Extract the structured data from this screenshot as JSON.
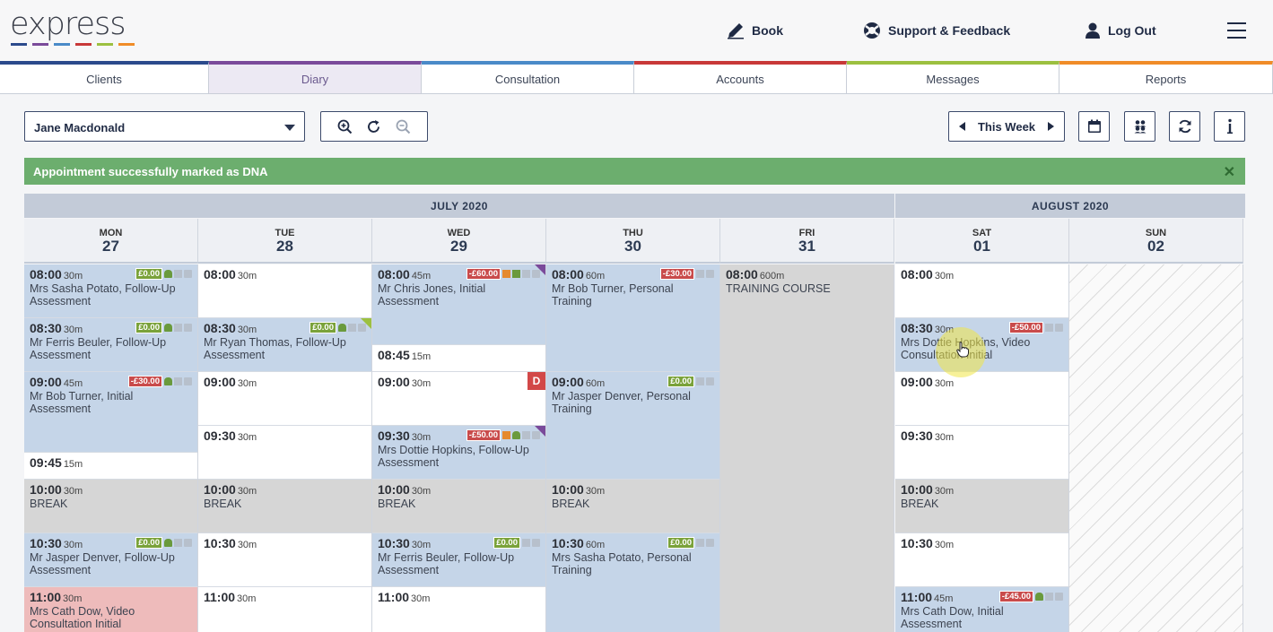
{
  "header": {
    "logo": "express",
    "logo_stripes": [
      "#2b4a8c",
      "#7a4a9a",
      "#4a8ac8",
      "#c83838",
      "#9cc040",
      "#f08c28"
    ],
    "book": "Book",
    "support": "Support & Feedback",
    "logout": "Log Out"
  },
  "tabs": [
    {
      "label": "Clients",
      "color": "#2b4a8c"
    },
    {
      "label": "Diary",
      "color": "#7a4a9a"
    },
    {
      "label": "Consultation",
      "color": "#4a8ac8"
    },
    {
      "label": "Accounts",
      "color": "#c83838"
    },
    {
      "label": "Messages",
      "color": "#9cc040"
    },
    {
      "label": "Reports",
      "color": "#f08c28"
    }
  ],
  "active_tab": "Diary",
  "toolbar": {
    "practitioner": "Jane Macdonald",
    "week_label": "This Week"
  },
  "alert": {
    "text": "Appointment successfully marked as DNA",
    "close": "✕"
  },
  "calendar": {
    "months": [
      "JULY 2020",
      "AUGUST 2020"
    ],
    "days": [
      {
        "name": "MON",
        "date": "27"
      },
      {
        "name": "TUE",
        "date": "28"
      },
      {
        "name": "WED",
        "date": "29"
      },
      {
        "name": "THU",
        "date": "30"
      },
      {
        "name": "FRI",
        "date": "31"
      },
      {
        "name": "SAT",
        "date": "01"
      },
      {
        "name": "SUN",
        "date": "02"
      }
    ],
    "events": [
      {
        "day": 0,
        "row": 0,
        "span": 1,
        "style": "blue",
        "time": "08:00",
        "dur": "30m",
        "name": "Mrs Sasha Potato, Follow-Up Assessment",
        "money": "£0.00",
        "mcls": "g",
        "icons": [
          "person",
          "list",
          "doc"
        ]
      },
      {
        "day": 0,
        "row": 1,
        "span": 1,
        "style": "blue",
        "time": "08:30",
        "dur": "30m",
        "name": "Mr Ferris Beuler, Follow-Up Assessment",
        "money": "£0.00",
        "mcls": "g",
        "icons": [
          "person",
          "list",
          "doc"
        ]
      },
      {
        "day": 0,
        "row": 2,
        "span": 1.5,
        "style": "blue",
        "time": "09:00",
        "dur": "45m",
        "name": "Mr Bob Turner, Initial Assessment",
        "money": "-£30.00",
        "mcls": "r",
        "icons": [
          "person",
          "list",
          "doc"
        ]
      },
      {
        "day": 0,
        "row": 3.5,
        "span": 0.5,
        "style": "white",
        "time": "09:45",
        "dur": "15m",
        "name": ""
      },
      {
        "day": 0,
        "row": 4,
        "span": 1,
        "style": "grey",
        "time": "10:00",
        "dur": "30m",
        "name": "BREAK"
      },
      {
        "day": 0,
        "row": 5,
        "span": 1,
        "style": "blue",
        "time": "10:30",
        "dur": "30m",
        "name": "Mr Jasper Denver, Follow-Up Assessment",
        "money": "£0.00",
        "mcls": "g",
        "icons": [
          "person",
          "list",
          "doc"
        ]
      },
      {
        "day": 0,
        "row": 6,
        "span": 1,
        "style": "pink",
        "time": "11:00",
        "dur": "30m",
        "name": "Mrs Cath Dow, Video Consultation Initial"
      },
      {
        "day": 1,
        "row": 0,
        "span": 1,
        "style": "white",
        "time": "08:00",
        "dur": "30m",
        "name": ""
      },
      {
        "day": 1,
        "row": 1,
        "span": 1,
        "style": "blue",
        "time": "08:30",
        "dur": "30m",
        "name": "Mr Ryan Thomas, Follow-Up Assessment",
        "money": "£0.00",
        "mcls": "g",
        "icons": [
          "person",
          "list",
          "doc"
        ],
        "corner": "#9cc040"
      },
      {
        "day": 1,
        "row": 2,
        "span": 1,
        "style": "white",
        "time": "09:00",
        "dur": "30m",
        "name": ""
      },
      {
        "day": 1,
        "row": 3,
        "span": 1,
        "style": "white",
        "time": "09:30",
        "dur": "30m",
        "name": ""
      },
      {
        "day": 1,
        "row": 4,
        "span": 1,
        "style": "grey",
        "time": "10:00",
        "dur": "30m",
        "name": "BREAK"
      },
      {
        "day": 1,
        "row": 5,
        "span": 1,
        "style": "white",
        "time": "10:30",
        "dur": "30m",
        "name": ""
      },
      {
        "day": 1,
        "row": 6,
        "span": 1,
        "style": "white",
        "time": "11:00",
        "dur": "30m",
        "name": ""
      },
      {
        "day": 2,
        "row": 0,
        "span": 1.5,
        "style": "blue",
        "time": "08:00",
        "dur": "45m",
        "name": "Mr Chris Jones, Initial Assessment",
        "money": "-£60.00",
        "mcls": "r",
        "icons": [
          "stack",
          "stackg",
          "list",
          "doc"
        ],
        "corner": "#7a4a9a"
      },
      {
        "day": 2,
        "row": 1.5,
        "span": 0.5,
        "style": "white",
        "time": "08:45",
        "dur": "15m",
        "name": ""
      },
      {
        "day": 2,
        "row": 2,
        "span": 1,
        "style": "white",
        "time": "09:00",
        "dur": "30m",
        "name": "",
        "dna": "D"
      },
      {
        "day": 2,
        "row": 3,
        "span": 1,
        "style": "blue",
        "time": "09:30",
        "dur": "30m",
        "name": "Mrs Dottie Hopkins, Follow-Up Assessment",
        "money": "-£50.00",
        "mcls": "r",
        "icons": [
          "stack",
          "person",
          "list",
          "doc"
        ],
        "corner": "#7a4a9a"
      },
      {
        "day": 2,
        "row": 4,
        "span": 1,
        "style": "grey",
        "time": "10:00",
        "dur": "30m",
        "name": "BREAK"
      },
      {
        "day": 2,
        "row": 5,
        "span": 1,
        "style": "blue",
        "time": "10:30",
        "dur": "30m",
        "name": "Mr Ferris Beuler, Follow-Up Assessment",
        "money": "£0.00",
        "mcls": "g",
        "icons": [
          "list",
          "doc"
        ]
      },
      {
        "day": 2,
        "row": 6,
        "span": 1,
        "style": "white",
        "time": "11:00",
        "dur": "30m",
        "name": ""
      },
      {
        "day": 3,
        "row": 0,
        "span": 2,
        "style": "blue",
        "time": "08:00",
        "dur": "60m",
        "name": "Mr Bob Turner, Personal Training",
        "money": "-£30.00",
        "mcls": "r",
        "icons": [
          "list",
          "doc"
        ]
      },
      {
        "day": 3,
        "row": 2,
        "span": 2,
        "style": "blue",
        "time": "09:00",
        "dur": "60m",
        "name": "Mr Jasper Denver, Personal Training",
        "money": "£0.00",
        "mcls": "g",
        "icons": [
          "list",
          "doc"
        ]
      },
      {
        "day": 3,
        "row": 4,
        "span": 1,
        "style": "grey",
        "time": "10:00",
        "dur": "30m",
        "name": "BREAK"
      },
      {
        "day": 3,
        "row": 5,
        "span": 2,
        "style": "blue",
        "time": "10:30",
        "dur": "60m",
        "name": "Mrs Sasha Potato, Personal Training",
        "money": "£0.00",
        "mcls": "g",
        "icons": [
          "list",
          "doc"
        ]
      },
      {
        "day": 4,
        "row": 0,
        "span": 7,
        "style": "grey",
        "time": "08:00",
        "dur": "600m",
        "name": "TRAINING COURSE"
      },
      {
        "day": 5,
        "row": 0,
        "span": 1,
        "style": "white",
        "time": "08:00",
        "dur": "30m",
        "name": ""
      },
      {
        "day": 5,
        "row": 1,
        "span": 1,
        "style": "blue",
        "time": "08:30",
        "dur": "30m",
        "name": "Mrs Dottie Hopkins, Video Consultation Initial",
        "money": "-£50.00",
        "mcls": "r",
        "icons": [
          "list",
          "doc"
        ]
      },
      {
        "day": 5,
        "row": 2,
        "span": 1,
        "style": "white",
        "time": "09:00",
        "dur": "30m",
        "name": ""
      },
      {
        "day": 5,
        "row": 3,
        "span": 1,
        "style": "white",
        "time": "09:30",
        "dur": "30m",
        "name": ""
      },
      {
        "day": 5,
        "row": 4,
        "span": 1,
        "style": "grey",
        "time": "10:00",
        "dur": "30m",
        "name": "BREAK"
      },
      {
        "day": 5,
        "row": 5,
        "span": 1,
        "style": "white",
        "time": "10:30",
        "dur": "30m",
        "name": ""
      },
      {
        "day": 5,
        "row": 6,
        "span": 1,
        "style": "blue",
        "time": "11:00",
        "dur": "45m",
        "name": "Mrs Cath Dow, Initial Assessment",
        "money": "-£45.00",
        "mcls": "r",
        "icons": [
          "person",
          "list",
          "doc"
        ]
      }
    ]
  }
}
